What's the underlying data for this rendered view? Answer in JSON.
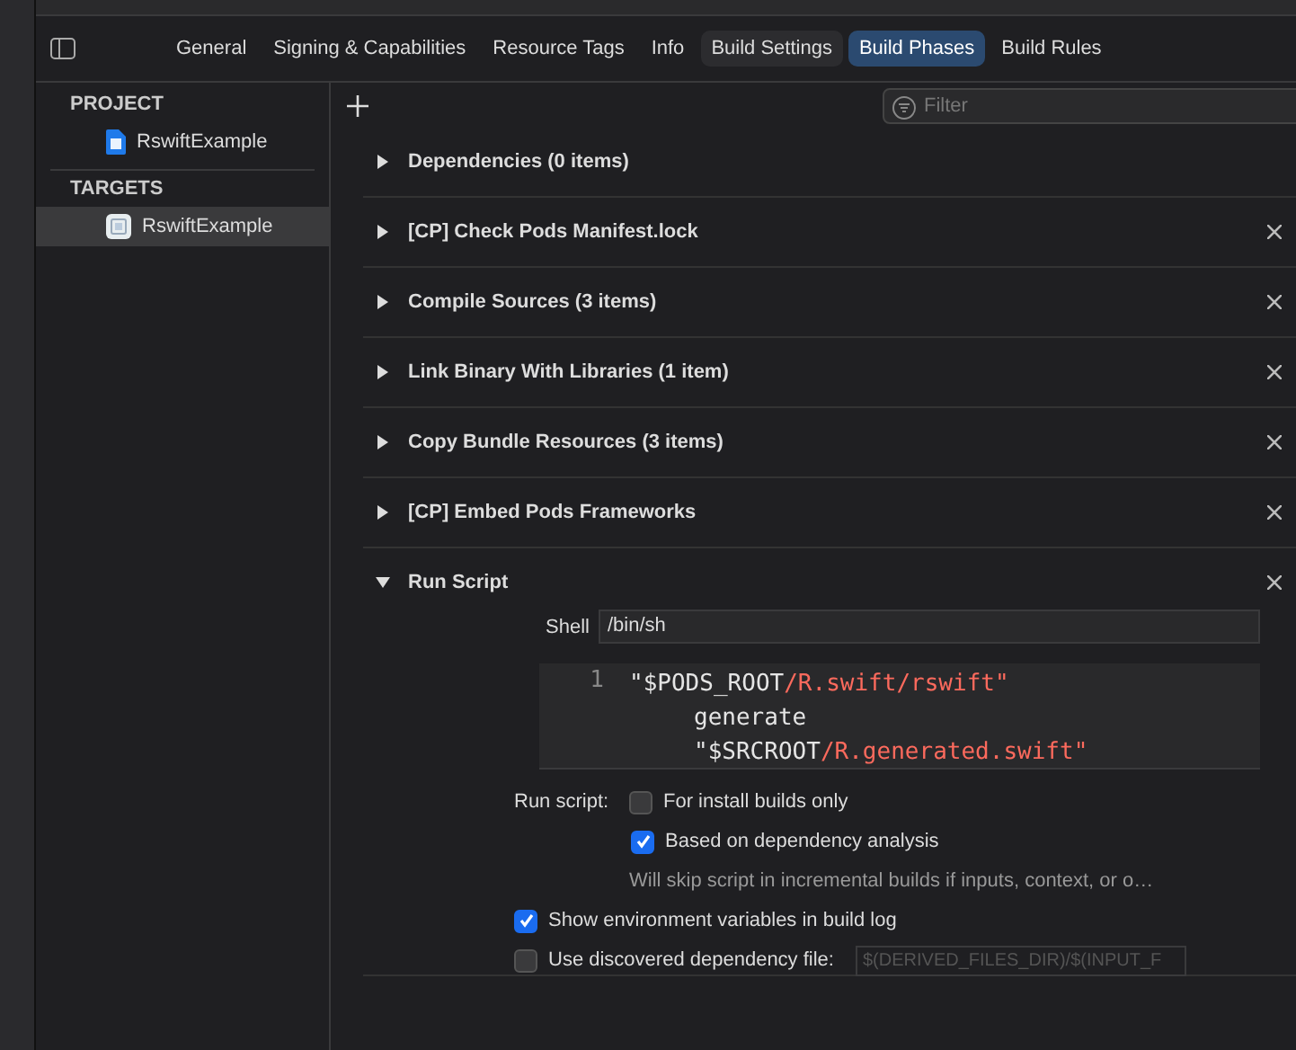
{
  "tabs": [
    {
      "label": "General",
      "selected": false
    },
    {
      "label": "Signing & Capabilities",
      "selected": false
    },
    {
      "label": "Resource Tags",
      "selected": false
    },
    {
      "label": "Info",
      "selected": false
    },
    {
      "label": "Build Settings",
      "selected": false,
      "hovered": true
    },
    {
      "label": "Build Phases",
      "selected": true
    },
    {
      "label": "Build Rules",
      "selected": false
    }
  ],
  "sidebar": {
    "sections": [
      {
        "title": "PROJECT",
        "items": [
          {
            "label": "RswiftExample",
            "kind": "project",
            "selected": false
          }
        ]
      },
      {
        "title": "TARGETS",
        "items": [
          {
            "label": "RswiftExample",
            "kind": "target",
            "selected": true
          }
        ]
      }
    ]
  },
  "filter": {
    "placeholder": "Filter"
  },
  "phases": [
    {
      "title": "Dependencies (0 items)",
      "expanded": false,
      "removable": false
    },
    {
      "title": "[CP] Check Pods Manifest.lock",
      "expanded": false,
      "removable": true
    },
    {
      "title": "Compile Sources (3 items)",
      "expanded": false,
      "removable": true
    },
    {
      "title": "Link Binary With Libraries (1 item)",
      "expanded": false,
      "removable": true
    },
    {
      "title": "Copy Bundle Resources (3 items)",
      "expanded": false,
      "removable": true
    },
    {
      "title": "[CP] Embed Pods Frameworks",
      "expanded": false,
      "removable": true
    },
    {
      "title": "Run Script",
      "expanded": true,
      "removable": true
    }
  ],
  "run_script": {
    "shell_label": "Shell",
    "shell": "/bin/sh",
    "code": {
      "line_number": "1",
      "lines": [
        {
          "wrapped": false,
          "parts": [
            {
              "kind": "plain",
              "text": "\"$PODS_ROOT"
            },
            {
              "kind": "string",
              "text": "/R.swift/rswift\""
            }
          ]
        },
        {
          "wrapped": true,
          "parts": [
            {
              "kind": "plain",
              "text": "generate"
            }
          ]
        },
        {
          "wrapped": true,
          "parts": [
            {
              "kind": "plain",
              "text": "\"$SRCROOT"
            },
            {
              "kind": "string",
              "text": "/R.generated.swift\""
            }
          ]
        }
      ]
    },
    "run_script_label": "Run script:",
    "install_only": {
      "label": "For install builds only",
      "checked": false
    },
    "dependency_analysis": {
      "label": "Based on dependency analysis",
      "checked": true
    },
    "hint": "Will skip script in incremental builds if inputs, context, or o…",
    "show_env": {
      "label": "Show environment variables in build log",
      "checked": true
    },
    "dep_file": {
      "label": "Use discovered dependency file:",
      "checked": false,
      "placeholder": "$(DERIVED_FILES_DIR)/$(INPUT_F"
    }
  }
}
